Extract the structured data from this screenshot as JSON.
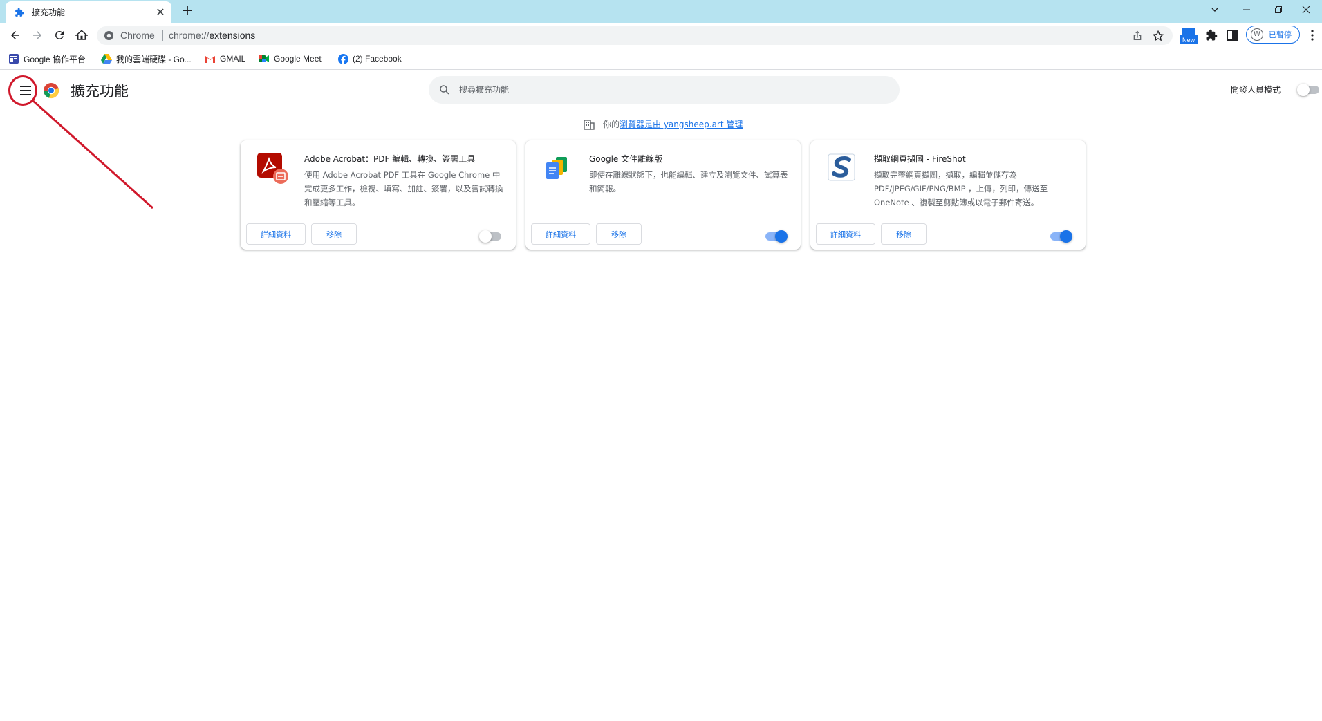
{
  "tab": {
    "title": "擴充功能",
    "close": "✕"
  },
  "toolbar": {
    "chip": "Chrome",
    "url_prefix": "chrome://",
    "url_host": "extensions",
    "profile_label": "已暫停",
    "new_badge": "New"
  },
  "bookmarks": [
    {
      "label": "Google 協作平台",
      "icon": "google-sites-icon"
    },
    {
      "label": "我的雲端硬碟 - Go...",
      "icon": "google-drive-icon"
    },
    {
      "label": "GMAIL",
      "icon": "gmail-icon"
    },
    {
      "label": "Google Meet",
      "icon": "google-meet-icon"
    },
    {
      "label": "(2) Facebook",
      "icon": "facebook-icon"
    }
  ],
  "page": {
    "title": "擴充功能",
    "search_placeholder": "搜尋擴充功能",
    "dev_mode_label": "開發人員模式",
    "managed_prefix": "你的",
    "managed_link": "瀏覽器是由 yangsheep.art 管理"
  },
  "extensions": [
    {
      "name": "Adobe Acrobat：PDF 編輯、轉換、簽署工具",
      "description": "使用 Adobe Acrobat PDF 工具在 Google Chrome 中完成更多工作，檢視、填寫、加註、簽署，以及嘗試轉換和壓縮等工具。",
      "details": "詳細資料",
      "remove": "移除",
      "enabled": false,
      "icon": "adobe-acrobat-icon"
    },
    {
      "name": "Google 文件離線版",
      "description": "即使在離線狀態下，也能編輯、建立及瀏覽文件、試算表和簡報。",
      "details": "詳細資料",
      "remove": "移除",
      "enabled": true,
      "icon": "google-docs-offline-icon"
    },
    {
      "name": "擷取網頁擷圖 - FireShot",
      "description": "擷取完整網頁擷圖，擷取，編輯並儲存為 PDF/JPEG/GIF/PNG/BMP ，上傳，列印，傳送至 OneNote 、複製至剪貼簿或以電子郵件寄送。",
      "details": "詳細資料",
      "remove": "移除",
      "enabled": true,
      "icon": "fireshot-icon"
    }
  ],
  "colors": {
    "accent": "#1a73e8",
    "tabstrip": "#b6e3f0",
    "annotation": "#d0182b"
  }
}
